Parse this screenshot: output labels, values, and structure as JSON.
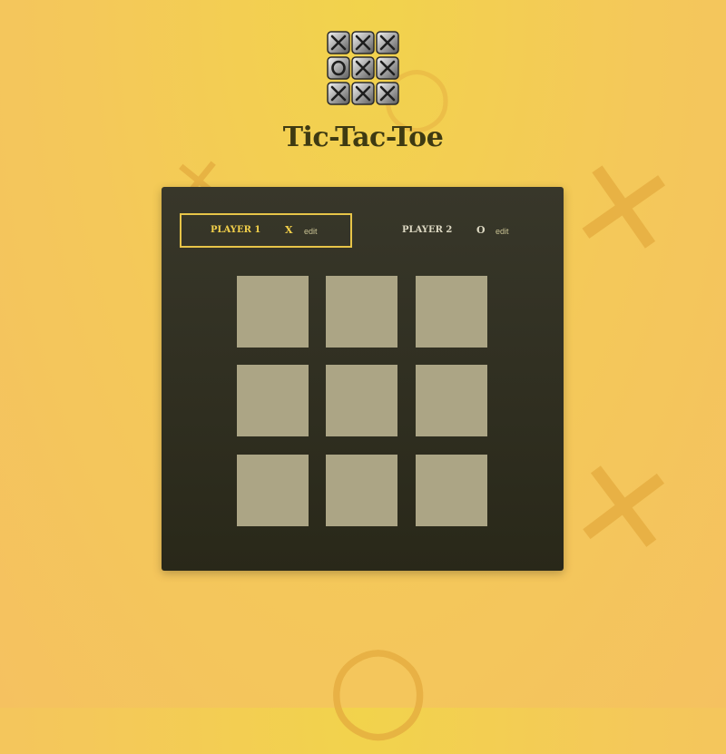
{
  "app": {
    "title": "Tic-Tac-Toe"
  },
  "players": [
    {
      "label": "PLAYER 1",
      "symbol": "X",
      "edit_label": "edit",
      "active": true
    },
    {
      "label": "PLAYER 2",
      "symbol": "O",
      "edit_label": "edit",
      "active": false
    }
  ],
  "board": {
    "cells": [
      "",
      "",
      "",
      "",
      "",
      "",
      "",
      "",
      ""
    ]
  },
  "colors": {
    "background": "#f4c85a",
    "card": "#2f2e20",
    "accent": "#f2d04a",
    "cell": "#aca585",
    "title": "#3e3a12"
  },
  "icons": {
    "logo": "tic-tac-toe-logo-icon"
  }
}
